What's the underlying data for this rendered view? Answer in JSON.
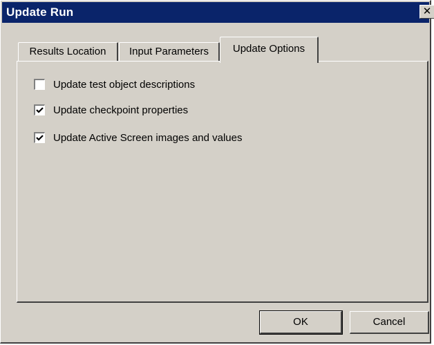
{
  "window": {
    "title": "Update Run",
    "close_label": "✕"
  },
  "tabs": [
    {
      "label": "Results Location",
      "active": false
    },
    {
      "label": "Input Parameters",
      "active": false
    },
    {
      "label": "Update Options",
      "active": true
    }
  ],
  "options": [
    {
      "label": "Update test object descriptions",
      "checked": false
    },
    {
      "label": "Update checkpoint properties",
      "checked": true
    },
    {
      "label": "Update Active Screen images and values",
      "checked": true
    }
  ],
  "buttons": {
    "ok_label": "OK",
    "cancel_label": "Cancel"
  },
  "colors": {
    "titlebar": "#0a246a",
    "face": "#d4d0c8"
  }
}
